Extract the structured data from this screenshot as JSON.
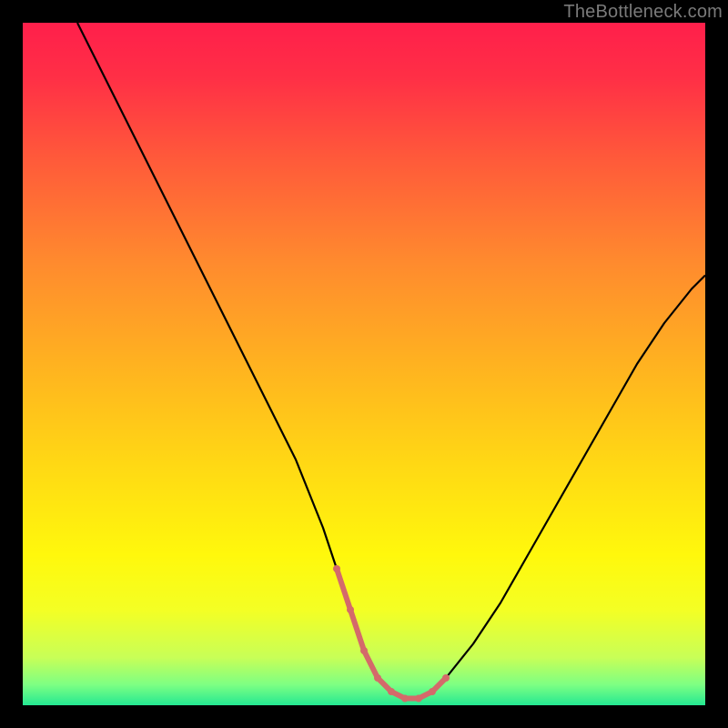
{
  "watermark": {
    "text": "TheBottleneck.com"
  },
  "colors": {
    "frame_bg": "#000000",
    "curve_stroke": "#000000",
    "well_stroke": "#d46a6a",
    "well_node": "#d46a6a",
    "gradient_stops": [
      {
        "offset": 0.0,
        "color": "#ff1f4b"
      },
      {
        "offset": 0.08,
        "color": "#ff2f46"
      },
      {
        "offset": 0.2,
        "color": "#ff5a3a"
      },
      {
        "offset": 0.35,
        "color": "#ff8a2e"
      },
      {
        "offset": 0.5,
        "color": "#ffb220"
      },
      {
        "offset": 0.65,
        "color": "#ffd914"
      },
      {
        "offset": 0.78,
        "color": "#fff80c"
      },
      {
        "offset": 0.86,
        "color": "#f4ff24"
      },
      {
        "offset": 0.93,
        "color": "#c8ff57"
      },
      {
        "offset": 0.97,
        "color": "#7dff83"
      },
      {
        "offset": 1.0,
        "color": "#24e892"
      }
    ]
  },
  "chart_data": {
    "type": "line",
    "title": "",
    "xlabel": "",
    "ylabel": "",
    "xlim": [
      0,
      100
    ],
    "ylim": [
      0,
      100
    ],
    "grid": false,
    "legend": null,
    "series": [
      {
        "name": "curve",
        "x": [
          8,
          12,
          16,
          20,
          24,
          28,
          32,
          36,
          40,
          44,
          46,
          48,
          50,
          52,
          54,
          56,
          58,
          60,
          62,
          66,
          70,
          74,
          78,
          82,
          86,
          90,
          94,
          98,
          100
        ],
        "values": [
          100,
          92,
          84,
          76,
          68,
          60,
          52,
          44,
          36,
          26,
          20,
          14,
          8,
          4,
          2,
          1,
          1,
          2,
          4,
          9,
          15,
          22,
          29,
          36,
          43,
          50,
          56,
          61,
          63
        ]
      }
    ],
    "well_region": {
      "x": [
        46,
        48,
        50,
        52,
        54,
        56,
        58,
        60,
        62
      ],
      "values": [
        20,
        14,
        8,
        4,
        2,
        1,
        1,
        2,
        4
      ]
    }
  }
}
